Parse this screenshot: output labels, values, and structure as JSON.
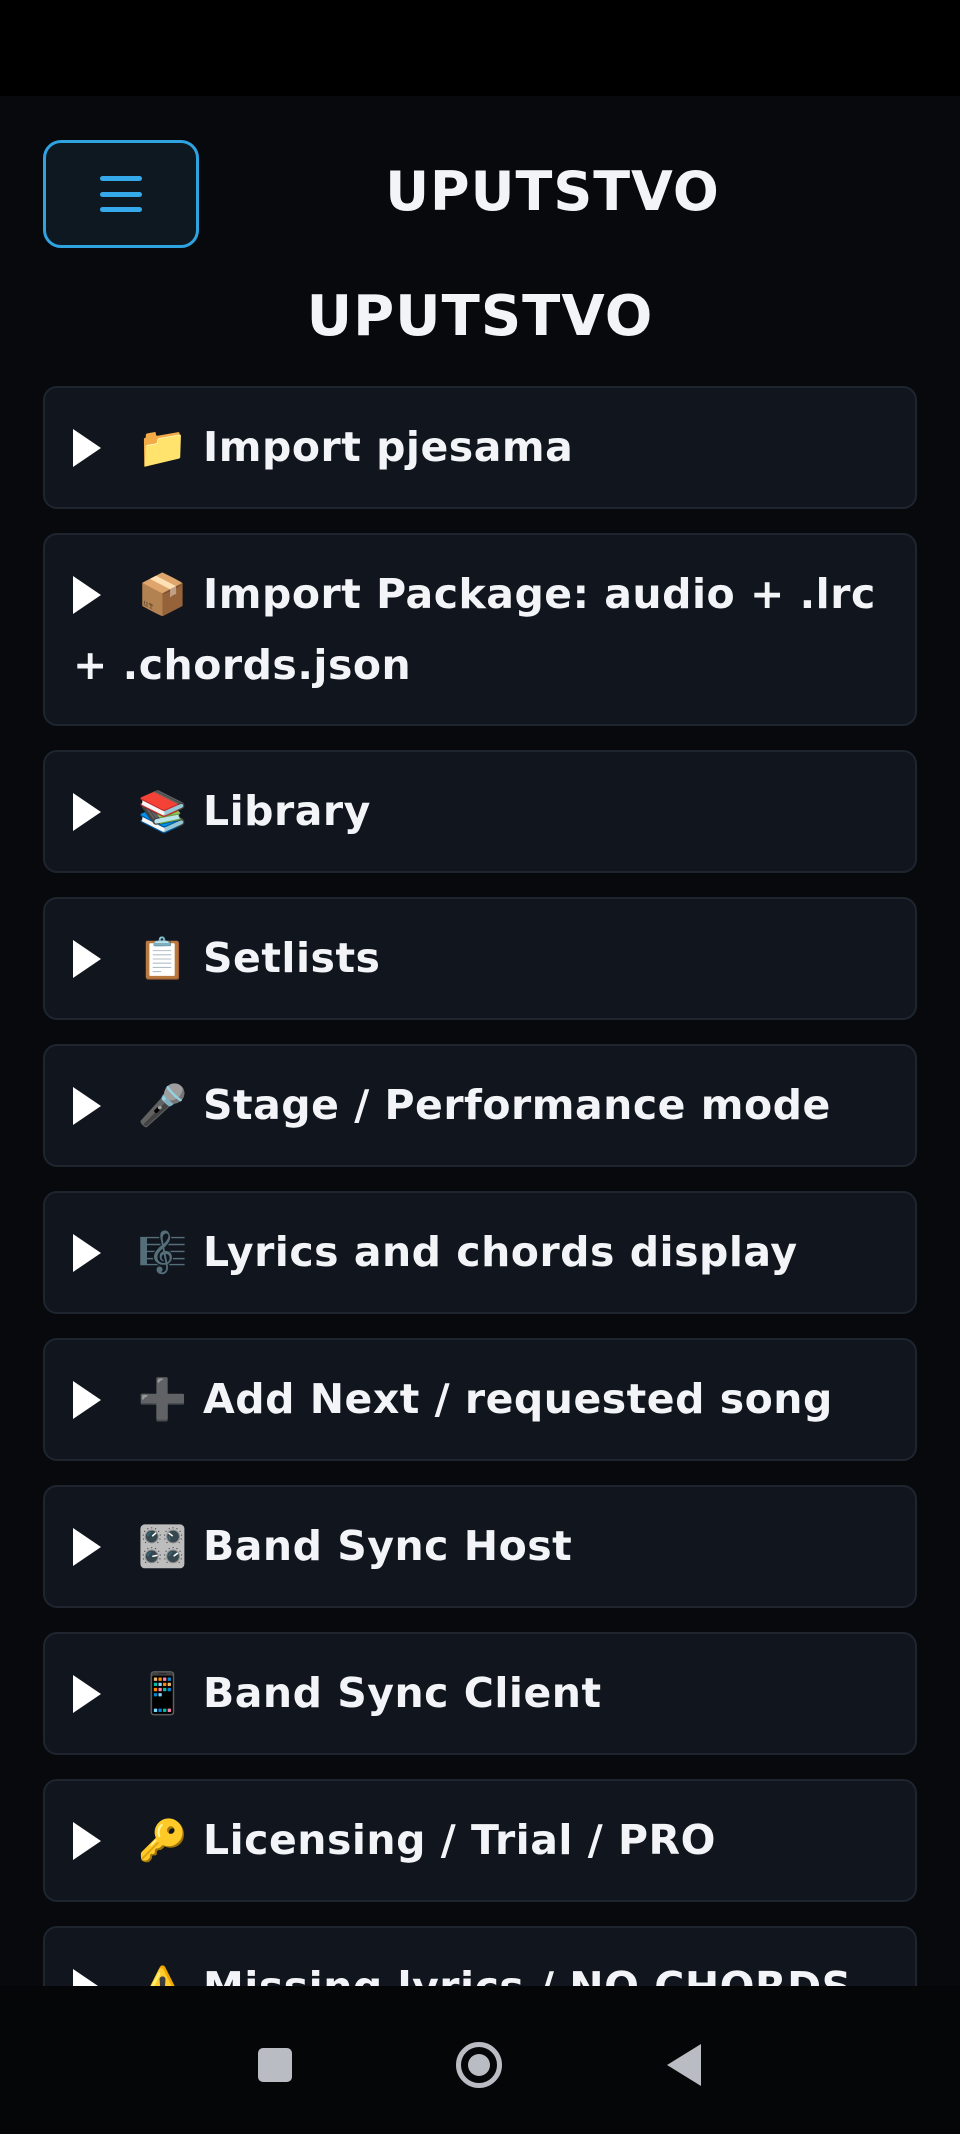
{
  "header": {
    "title": "UPUTSTVO",
    "menu_icon": "hamburger-menu-icon"
  },
  "page": {
    "title": "UPUTSTVO"
  },
  "sections": [
    {
      "emoji": "📁",
      "label": "Import pjesama",
      "icon": "folder-icon"
    },
    {
      "emoji": "📦",
      "label": "Import Package: audio + .lrc",
      "label_cont": "+ .chords.json",
      "icon": "package-icon"
    },
    {
      "emoji": "📚",
      "label": "Library",
      "icon": "books-icon"
    },
    {
      "emoji": "📋",
      "label": "Setlists",
      "icon": "clipboard-icon"
    },
    {
      "emoji": "🎤",
      "label": "Stage / Performance mode",
      "icon": "microphone-icon"
    },
    {
      "emoji": "🎼",
      "label": "Lyrics and chords display",
      "icon": "musical-score-icon"
    },
    {
      "emoji": "➕",
      "label": "Add Next / requested song",
      "icon": "plus-icon"
    },
    {
      "emoji": "🎛️",
      "label": "Band Sync Host",
      "icon": "control-knobs-icon"
    },
    {
      "emoji": "📱",
      "label": "Band Sync Client",
      "icon": "mobile-phone-icon"
    },
    {
      "emoji": "🔑",
      "label": "Licensing / Trial / PRO",
      "icon": "key-icon"
    },
    {
      "emoji": "⚠️",
      "label": "Missing lyrics / NO CHORDS",
      "icon": "warning-icon"
    }
  ],
  "colors": {
    "accent": "#2fa3e0",
    "background": "#07090c",
    "card": "#11161e",
    "text": "#f2f4f7"
  },
  "system_nav": {
    "recents_icon": "recents-square-icon",
    "home_icon": "home-circle-icon",
    "back_icon": "back-triangle-icon"
  }
}
